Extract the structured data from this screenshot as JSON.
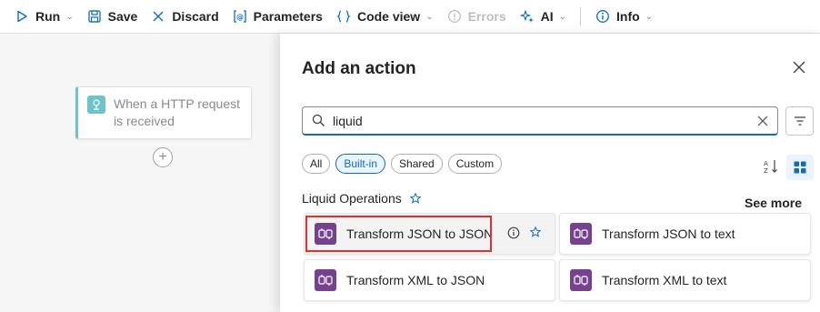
{
  "toolbar": {
    "run": "Run",
    "save": "Save",
    "discard": "Discard",
    "parameters": "Parameters",
    "code_view": "Code view",
    "errors": "Errors",
    "ai": "AI",
    "info": "Info"
  },
  "canvas": {
    "trigger_label": "When a HTTP request is received"
  },
  "panel": {
    "title": "Add an action",
    "search_value": "liquid",
    "filters": [
      "All",
      "Built-in",
      "Shared",
      "Custom"
    ],
    "active_filter": "Built-in",
    "section_title": "Liquid Operations",
    "see_more": "See more",
    "actions": [
      "Transform JSON to JSON",
      "Transform JSON to text",
      "Transform XML to JSON",
      "Transform XML to text"
    ]
  },
  "colors": {
    "accent": "#0f6cbd",
    "action_icon": "#77428d",
    "trigger_icon": "#6cc3c8",
    "highlight": "#e03131"
  }
}
